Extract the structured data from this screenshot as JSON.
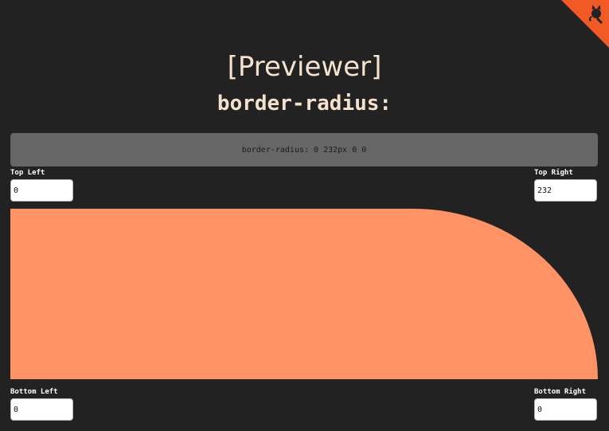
{
  "header": {
    "title": "[Previewer]",
    "subtitle": "border-radius:"
  },
  "output": {
    "css_text": "border-radius: 0 232px 0 0"
  },
  "fields": {
    "top_left": {
      "label": "Top Left",
      "value": "0"
    },
    "top_right": {
      "label": "Top Right",
      "value": "232"
    },
    "bottom_left": {
      "label": "Bottom Left",
      "value": "0"
    },
    "bottom_right": {
      "label": "Bottom Right",
      "value": "0"
    }
  },
  "colors": {
    "background": "#222222",
    "title": "#f4e2cf",
    "code_box": "#666666",
    "preview_shape": "#ff9366",
    "corner_ribbon": "#f15a24"
  },
  "icons": {
    "corner": "github-octocat-icon"
  }
}
